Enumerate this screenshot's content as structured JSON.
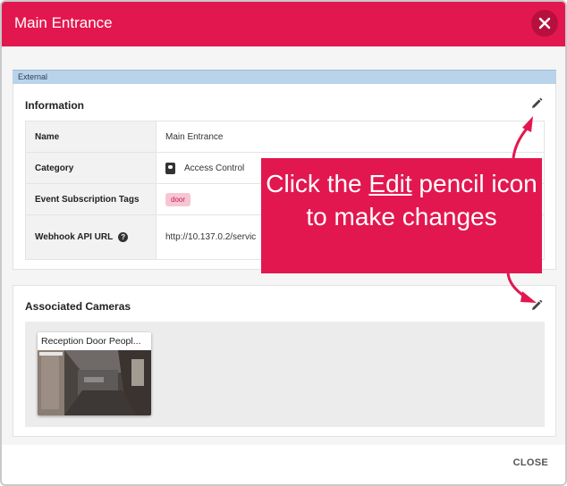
{
  "header": {
    "title": "Main Entrance"
  },
  "section_label": "External",
  "information": {
    "title": "Information",
    "rows": [
      {
        "key": "Name",
        "value": "Main Entrance"
      },
      {
        "key": "Category",
        "value": "Access Control"
      },
      {
        "key": "Event Subscription Tags",
        "value": "door"
      },
      {
        "key": "Webhook API URL",
        "value": "http://10.137.0.2/servic"
      }
    ],
    "help_glyph": "?"
  },
  "cameras": {
    "title": "Associated Cameras",
    "items": [
      {
        "name": "Reception Door Peopl..."
      }
    ]
  },
  "callout": {
    "before": "Click the ",
    "link": "Edit",
    "after": " pencil icon to make changes"
  },
  "footer": {
    "close_label": "CLOSE"
  },
  "colors": {
    "brand": "#e3174f",
    "section_bar": "#b9d4ea",
    "tag_bg": "#f7c6d3"
  }
}
